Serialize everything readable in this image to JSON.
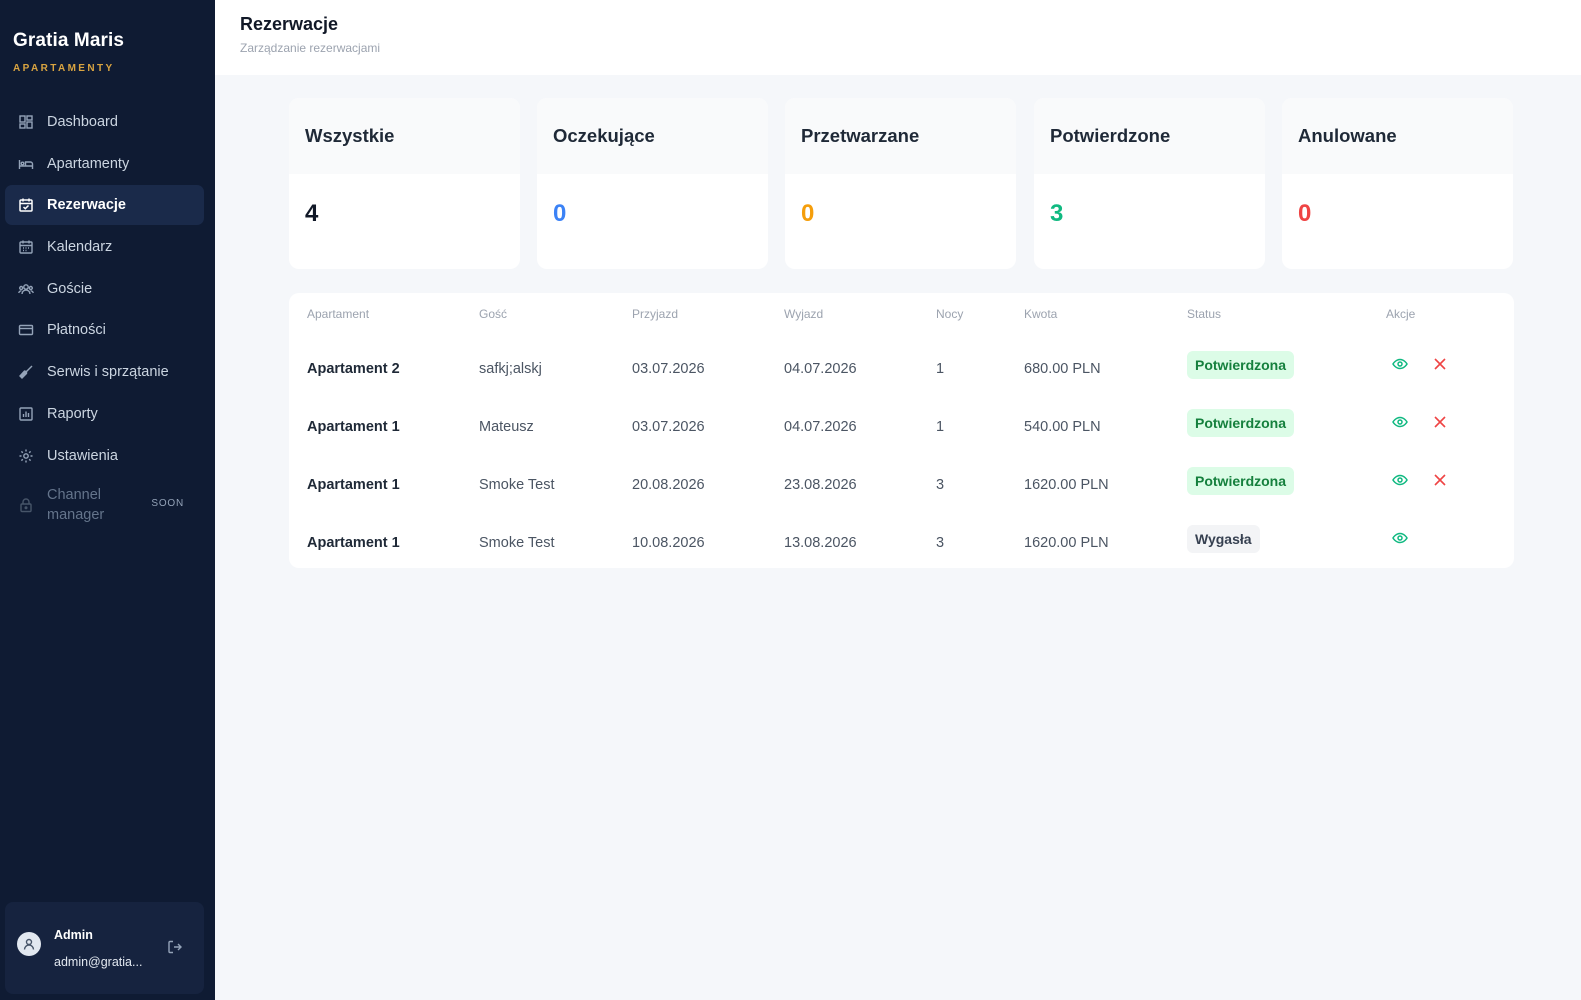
{
  "brand": {
    "name": "Gratia Maris",
    "sub": "APARTAMENTY"
  },
  "nav": [
    {
      "label": "Dashboard",
      "icon": "dashboard-icon",
      "active": false
    },
    {
      "label": "Apartamenty",
      "icon": "bed-icon",
      "active": false
    },
    {
      "label": "Rezerwacje",
      "icon": "calendar-check-icon",
      "active": true
    },
    {
      "label": "Kalendarz",
      "icon": "calendar-icon",
      "active": false
    },
    {
      "label": "Goście",
      "icon": "users-icon",
      "active": false
    },
    {
      "label": "Płatności",
      "icon": "credit-card-icon",
      "active": false
    },
    {
      "label": "Serwis i sprzątanie",
      "icon": "broom-icon",
      "active": false
    },
    {
      "label": "Raporty",
      "icon": "bar-chart-icon",
      "active": false
    },
    {
      "label": "Ustawienia",
      "icon": "gear-icon",
      "active": false
    }
  ],
  "nav_disabled": {
    "label": "Channel manager",
    "badge": "SOON",
    "icon": "lock-icon"
  },
  "user": {
    "name": "Admin",
    "email": "admin@gratia..."
  },
  "header": {
    "title": "Rezerwacje",
    "subtitle": "Zarządzanie rezerwacjami"
  },
  "stats": [
    {
      "label": "Wszystkie",
      "value": "4",
      "color": "#111827"
    },
    {
      "label": "Oczekujące",
      "value": "0",
      "color": "#3b82f6"
    },
    {
      "label": "Przetwarzane",
      "value": "0",
      "color": "#f59e0b"
    },
    {
      "label": "Potwierdzone",
      "value": "3",
      "color": "#10b981"
    },
    {
      "label": "Anulowane",
      "value": "0",
      "color": "#ef4444"
    }
  ],
  "table": {
    "headers": [
      "Apartament",
      "Gość",
      "Przyjazd",
      "Wyjazd",
      "Nocy",
      "Kwota",
      "Status",
      "Akcje"
    ],
    "rows": [
      {
        "apartment": "Apartament 2",
        "guest": "safkj;alskj",
        "arrival": "03.07.2026",
        "departure": "04.07.2026",
        "nights": "1",
        "amount": "680.00 PLN",
        "status": "Potwierdzona",
        "status_type": "ok",
        "can_cancel": true
      },
      {
        "apartment": "Apartament 1",
        "guest": "Mateusz",
        "arrival": "03.07.2026",
        "departure": "04.07.2026",
        "nights": "1",
        "amount": "540.00 PLN",
        "status": "Potwierdzona",
        "status_type": "ok",
        "can_cancel": true
      },
      {
        "apartment": "Apartament 1",
        "guest": "Smoke Test",
        "arrival": "20.08.2026",
        "departure": "23.08.2026",
        "nights": "3",
        "amount": "1620.00 PLN",
        "status": "Potwierdzona",
        "status_type": "ok",
        "can_cancel": true
      },
      {
        "apartment": "Apartament 1",
        "guest": "Smoke Test",
        "arrival": "10.08.2026",
        "departure": "13.08.2026",
        "nights": "3",
        "amount": "1620.00 PLN",
        "status": "Wygasła",
        "status_type": "exp",
        "can_cancel": false
      }
    ]
  },
  "colors": {
    "sidebar": "#0f1b33",
    "brand_accent": "#d9a441",
    "view_icon": "#10b981",
    "cancel_icon": "#ef4444"
  }
}
